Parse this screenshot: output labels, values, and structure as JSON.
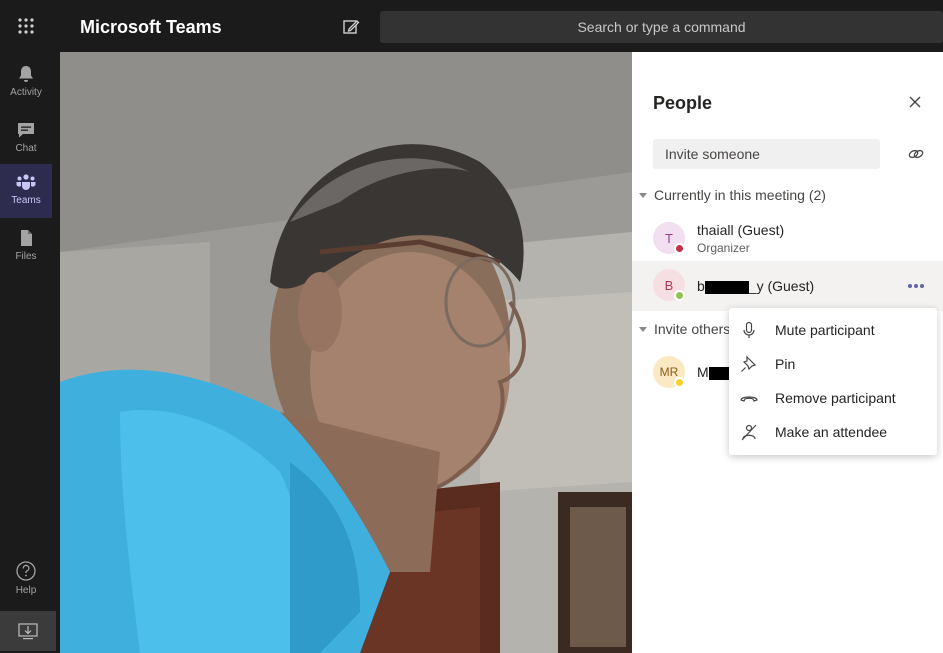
{
  "app": {
    "title": "Microsoft Teams",
    "search_placeholder": "Search or type a command"
  },
  "rail": {
    "items": [
      {
        "label": "Activity",
        "icon": "bell-icon"
      },
      {
        "label": "Chat",
        "icon": "chat-icon"
      },
      {
        "label": "Teams",
        "icon": "teams-icon",
        "active": true
      },
      {
        "label": "Files",
        "icon": "file-icon"
      }
    ],
    "help_label": "Help"
  },
  "people_panel": {
    "title": "People",
    "invite_placeholder": "Invite someone",
    "current_section": "Currently in this meeting (2)",
    "others_section": "Invite others",
    "participants": [
      {
        "initials": "T",
        "name": "thaiall (Guest)",
        "role": "Organizer",
        "status_color": "#c4314b"
      },
      {
        "initials": "B",
        "name_prefix": "b",
        "name_suffix": "_y (Guest)",
        "status_color": "#92c353"
      }
    ],
    "invitees": [
      {
        "initials": "MR",
        "name_prefix": "M",
        "status_color": "#f8d22a"
      }
    ]
  },
  "context_menu": {
    "items": [
      {
        "label": "Mute participant",
        "icon": "microphone-icon"
      },
      {
        "label": "Pin",
        "icon": "pin-icon"
      },
      {
        "label": "Remove participant",
        "icon": "hang-up-icon"
      },
      {
        "label": "Make an attendee",
        "icon": "make-attendee-icon"
      }
    ]
  },
  "colors": {
    "accent": "#6264a7",
    "rail_bg": "#1b1b1b",
    "panel_bg": "#ffffff"
  }
}
